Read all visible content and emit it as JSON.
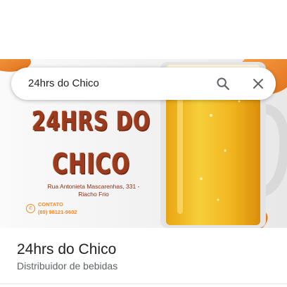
{
  "search": {
    "query": "24hrs do Chico"
  },
  "poster": {
    "title_line1": "24HRS DO",
    "title_line2": "CHICO",
    "address_line1": "Rua Antonieta Mascarenhas, 331 -",
    "address_line2": "Riacho Frio",
    "contact_label": "CONTATO",
    "contact_phone": "(89) 98121-9602"
  },
  "place": {
    "name": "24hrs do Chico",
    "category": "Distribuidor de bebidas"
  },
  "icons": {
    "search": "search-icon",
    "close": "close-icon",
    "phone": "phone-icon"
  },
  "colors": {
    "title": "#9a3b1f",
    "accent": "#f08a2e",
    "beer": "#f2b51f"
  }
}
